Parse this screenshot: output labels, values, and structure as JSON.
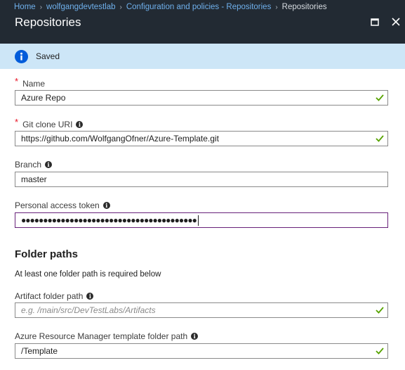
{
  "breadcrumb": {
    "items": [
      "Home",
      "wolfgangdevtestlab",
      "Configuration and policies - Repositories"
    ],
    "current": "Repositories"
  },
  "blade": {
    "title": "Repositories"
  },
  "notification": {
    "text": "Saved",
    "icon": "info-icon",
    "color": "#015cda"
  },
  "form": {
    "name": {
      "label": "Name",
      "required": true,
      "value": "Azure Repo",
      "valid": true
    },
    "git_clone_uri": {
      "label": "Git clone URI",
      "required": true,
      "value": "https://github.com/WolfgangOfner/Azure-Template.git",
      "valid": true
    },
    "branch": {
      "label": "Branch",
      "value": "master"
    },
    "personal_access_token": {
      "label": "Personal access token",
      "value": "●●●●●●●●●●●●●●●●●●●●●●●●●●●●●●●●●●●●●●●●"
    },
    "folder_paths": {
      "title": "Folder paths",
      "hint": "At least one folder path is required below",
      "artifact": {
        "label": "Artifact folder path",
        "placeholder": "e.g. /main/src/DevTestLabs/Artifacts",
        "valid": true
      },
      "arm_template": {
        "label": "Azure Resource Manager template folder path",
        "value": "/Template",
        "valid": true
      }
    }
  },
  "colors": {
    "topbar": "#222a33",
    "link": "#6fb0ec",
    "notice_bg": "#cde6f7",
    "check": "#57a300",
    "focus": "#68217a"
  }
}
